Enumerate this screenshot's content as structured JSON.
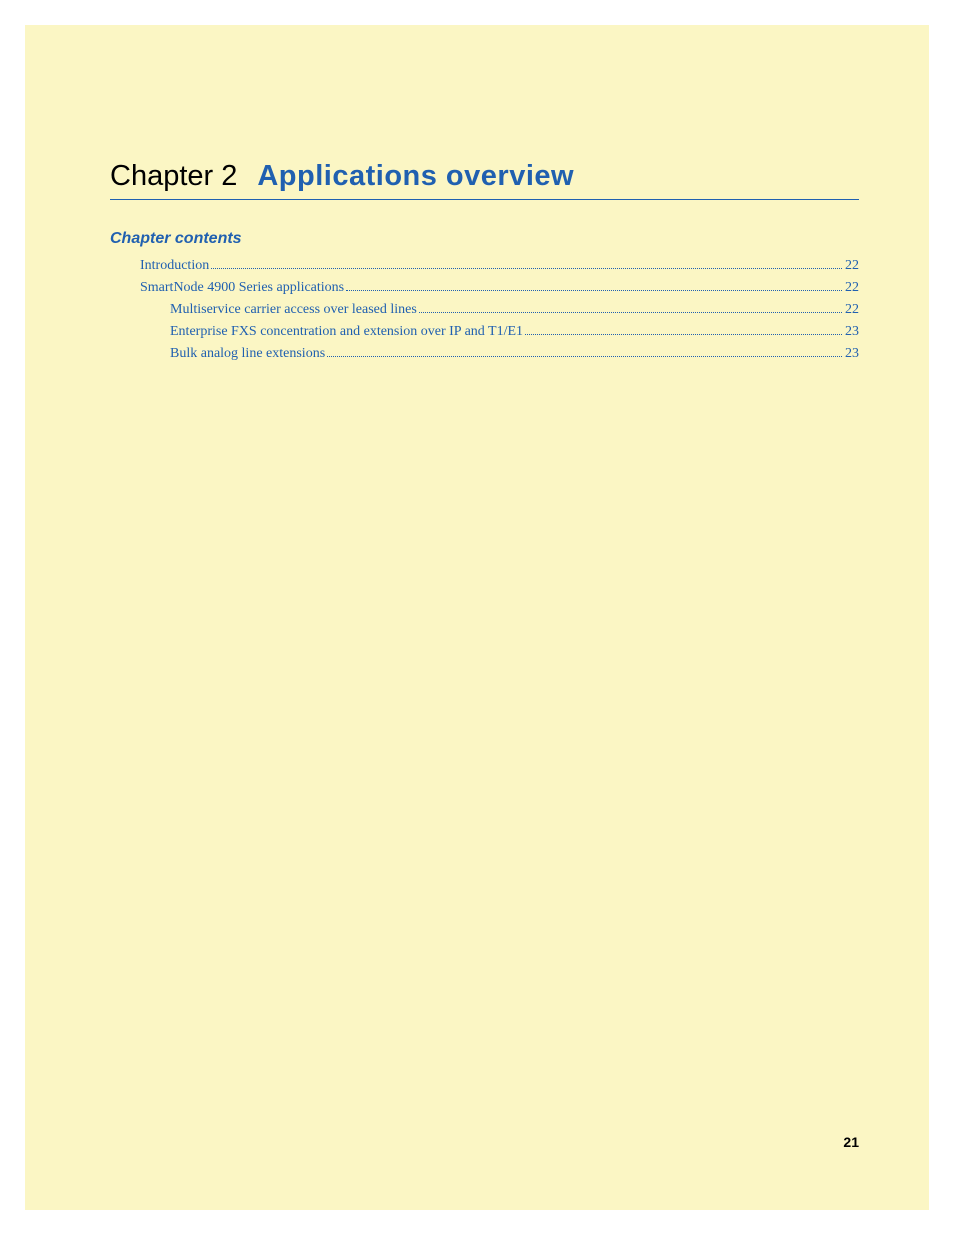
{
  "chapter": {
    "label": "Chapter 2",
    "title": "Applications overview"
  },
  "contents_heading": "Chapter contents",
  "toc": [
    {
      "label": "Introduction",
      "page": "22",
      "level": 1
    },
    {
      "label": "SmartNode 4900 Series applications",
      "page": "22",
      "level": 1
    },
    {
      "label": "Multiservice carrier access over leased lines ",
      "page": "22",
      "level": 2
    },
    {
      "label": "Enterprise FXS concentration and extension over IP and T1/E1 ",
      "page": "23",
      "level": 2
    },
    {
      "label": "Bulk analog line extensions ",
      "page": "23",
      "level": 2
    }
  ],
  "page_number": "21"
}
